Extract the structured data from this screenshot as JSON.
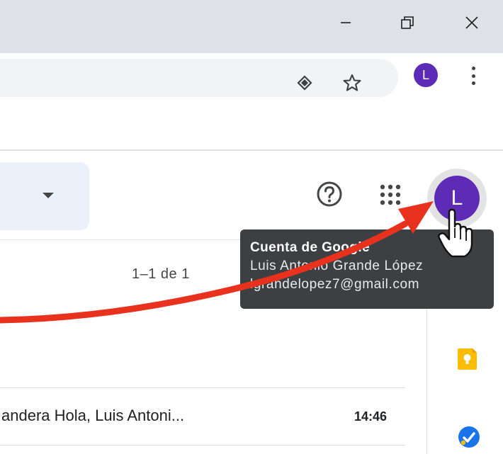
{
  "window": {
    "minimize_icon": "minimize-icon",
    "restore_icon": "restore-icon",
    "close_icon": "close-icon"
  },
  "toolbar": {
    "lens_icon": "google-lens-icon",
    "bookmark_icon": "star-icon",
    "profile_initial": "L",
    "menu_icon": "kebab-menu-icon"
  },
  "gmail_header": {
    "help_icon": "help-icon",
    "apps_icon": "apps-grid-icon",
    "account_initial": "L"
  },
  "mail_list": {
    "pagination": "1–1 de 1",
    "rows": [
      {
        "snippet": "andera Hola, Luis Antoni...",
        "time": "14:46"
      }
    ]
  },
  "tooltip": {
    "title": "Cuenta de Google",
    "name": "Luis Antonio Grande López",
    "email": "lgrandelopez7@gmail.com"
  },
  "side_panel": {
    "keep_icon": "keep-icon",
    "tasks_icon": "tasks-icon"
  },
  "colors": {
    "avatar": "#5e2bb6",
    "annotation_arrow": "#e8321e",
    "tooltip_bg": "#3c4043"
  }
}
